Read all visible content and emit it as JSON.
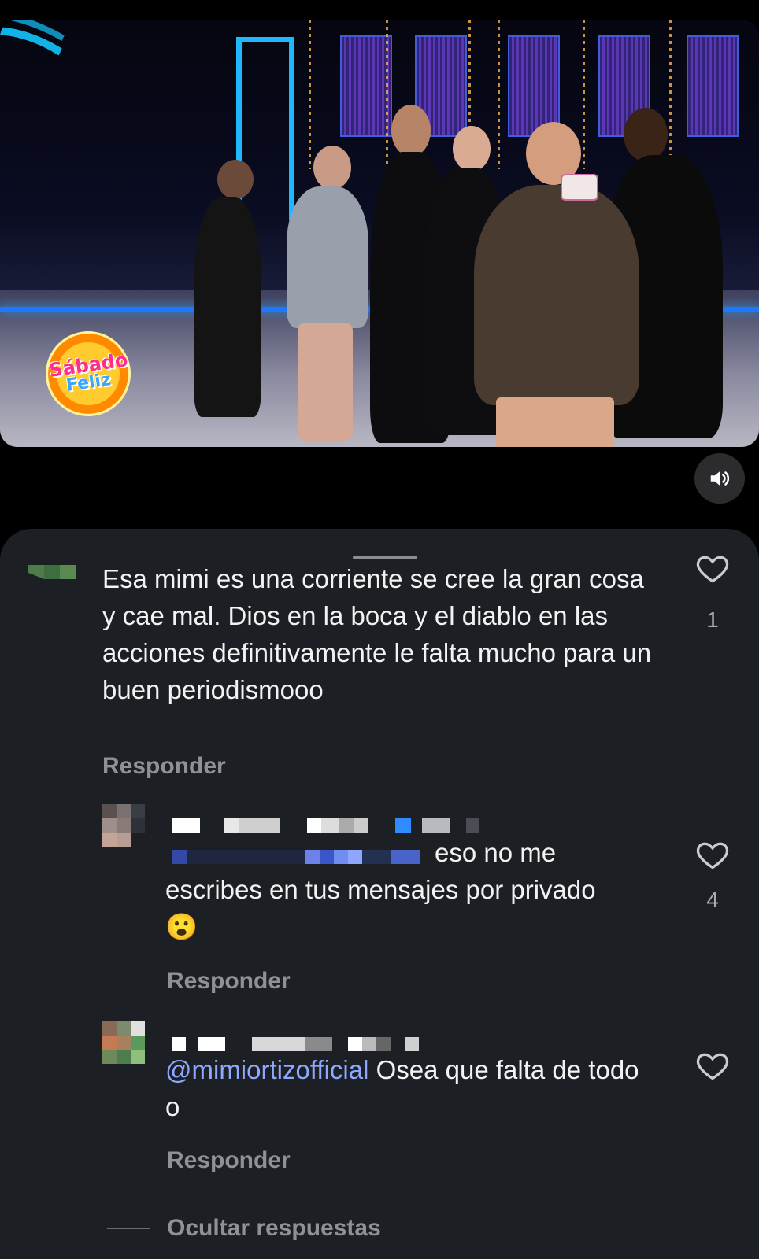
{
  "video": {
    "show_logo_line1": "Sábado",
    "show_logo_line2": "Feliz",
    "sound_icon": "volume-on-icon"
  },
  "comments": [
    {
      "username": "",
      "text": "Esa mimi es una corriente se cree la gran cosa y cae mal. Dios en la boca y el diablo en las acciones definitivamente le falta mucho para un buen periodismooo",
      "likes": "1",
      "reply_label": "Responder"
    },
    {
      "username": "",
      "text_line1": "eso no me",
      "text_rest": "escribes en tus mensajes por privado 😮",
      "likes": "4",
      "reply_label": "Responder"
    },
    {
      "username": "",
      "mention": "@mimiortizofficial",
      "text": " Osea que falta de todo o",
      "likes": "",
      "reply_label": "Responder"
    }
  ],
  "hide_replies_label": "Ocultar respuestas",
  "colors": {
    "sheet_bg": "#1c1f23",
    "mention": "#8fa8ff",
    "muted": "#8e9196"
  }
}
